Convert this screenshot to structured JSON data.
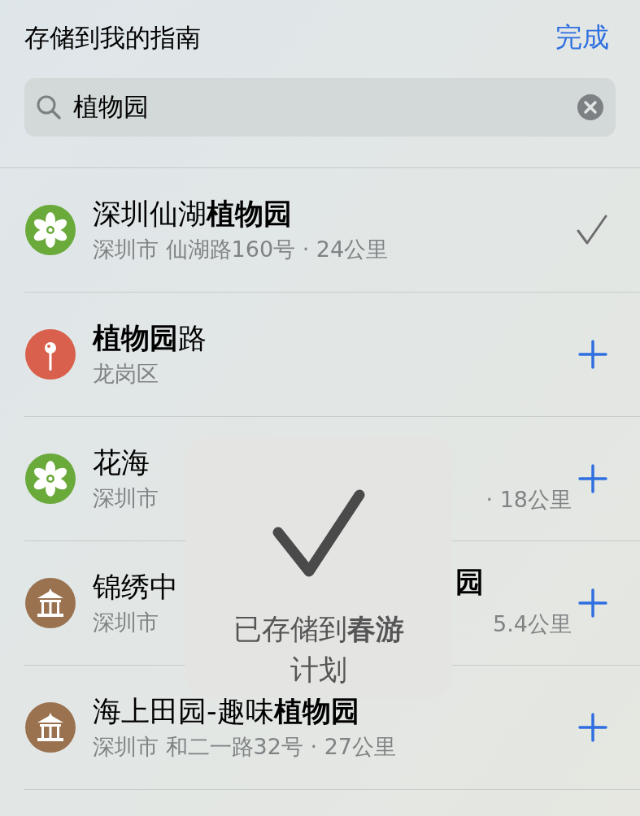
{
  "header": {
    "title": "存储到我的指南",
    "done": "完成"
  },
  "search": {
    "value": "植物园"
  },
  "results": [
    {
      "kind": "flower",
      "color": "#6aaa3a",
      "title": "深圳仙湖**植物园**",
      "subtitle": "深圳市 仙湖路160号 · 24公里",
      "added": true
    },
    {
      "kind": "pin",
      "color": "#d9604c",
      "title": "**植物园**路",
      "subtitle": "龙岗区",
      "added": false
    },
    {
      "kind": "flower",
      "color": "#6aaa3a",
      "title": "花海",
      "subtitle": "深圳市",
      "subtitle_right": "· 18公里",
      "added": false
    },
    {
      "kind": "pavilion",
      "color": "#9a7250",
      "title": "锦绣中",
      "title_right": "园",
      "title_right_bold": true,
      "subtitle": "深圳市",
      "subtitle_right": "5.4公里",
      "added": false
    },
    {
      "kind": "pavilion",
      "color": "#9a7250",
      "title": "海上田园-趣味**植物园**",
      "subtitle": "深圳市 和二一路32号 · 27公里",
      "added": false
    }
  ],
  "toast": {
    "message": "已存储到**春游**计划"
  }
}
